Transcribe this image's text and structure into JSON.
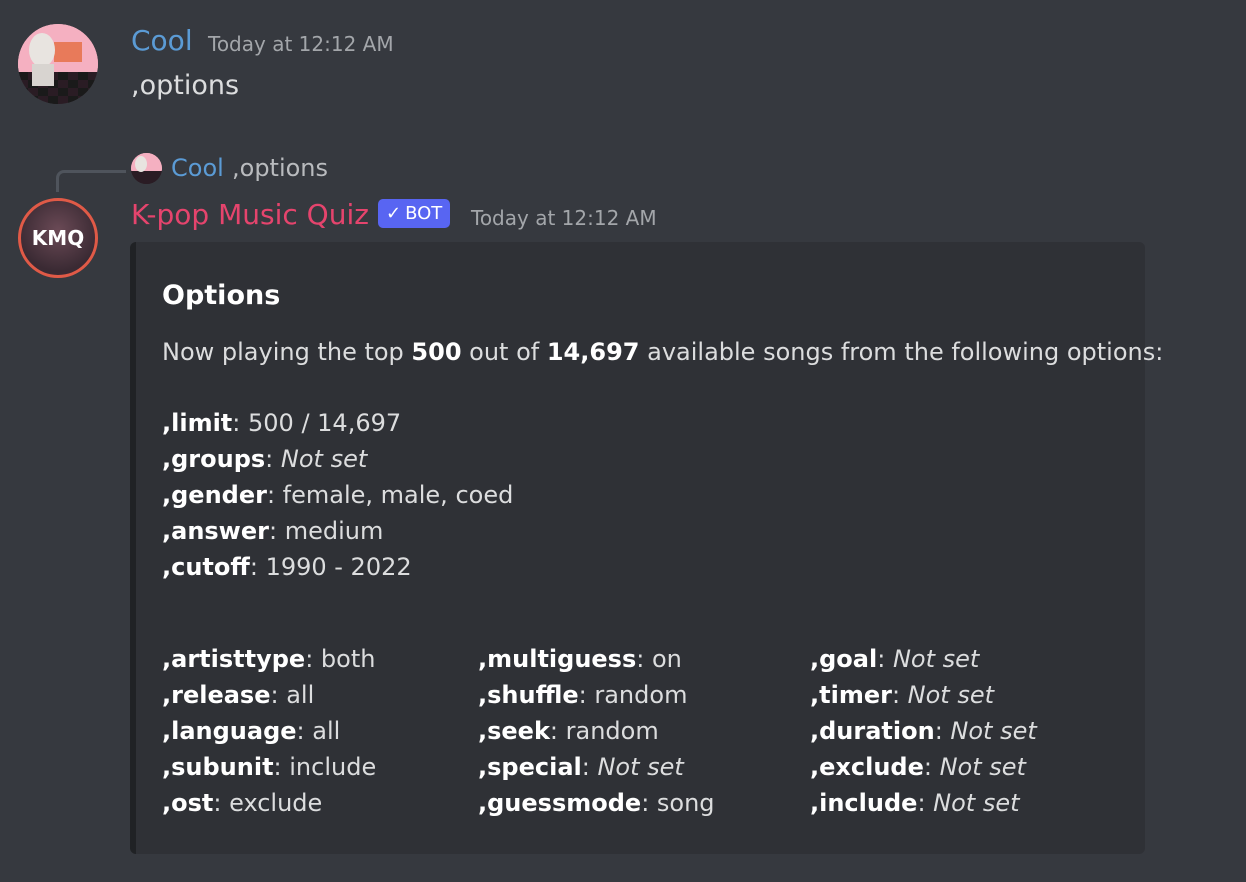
{
  "message1": {
    "username": "Cool",
    "timestamp": "Today at 12:12 AM",
    "content": ",options"
  },
  "reply": {
    "username": "Cool",
    "content": ",options"
  },
  "message2": {
    "avatar_text": "KMQ",
    "username": "K-pop Music Quiz",
    "badge": "BOT",
    "badge_check": "✓",
    "timestamp": "Today at 12:12 AM",
    "embed": {
      "title": "Options",
      "desc_pre": "Now playing the top ",
      "desc_top": "500",
      "desc_mid": " out of ",
      "desc_total": "14,697",
      "desc_post": " available songs from the following options:",
      "main_options": [
        {
          "key": ",limit",
          "value": "500 / 14,697",
          "italic": false
        },
        {
          "key": ",groups",
          "value": "Not set",
          "italic": true
        },
        {
          "key": ",gender",
          "value": "female, male, coed",
          "italic": false
        },
        {
          "key": ",answer",
          "value": "medium",
          "italic": false
        },
        {
          "key": ",cutoff",
          "value": "1990 - 2022",
          "italic": false
        }
      ],
      "col1": [
        {
          "key": ",artisttype",
          "value": "both",
          "italic": false
        },
        {
          "key": ",release",
          "value": "all",
          "italic": false
        },
        {
          "key": ",language",
          "value": "all",
          "italic": false
        },
        {
          "key": ",subunit",
          "value": "include",
          "italic": false
        },
        {
          "key": ",ost",
          "value": "exclude",
          "italic": false
        }
      ],
      "col2": [
        {
          "key": ",multiguess",
          "value": "on",
          "italic": false
        },
        {
          "key": ",shuffle",
          "value": "random",
          "italic": false
        },
        {
          "key": ",seek",
          "value": "random",
          "italic": false
        },
        {
          "key": ",special",
          "value": "Not set",
          "italic": true
        },
        {
          "key": ",guessmode",
          "value": "song",
          "italic": false
        }
      ],
      "col3": [
        {
          "key": ",goal",
          "value": "Not set",
          "italic": true
        },
        {
          "key": ",timer",
          "value": "Not set",
          "italic": true
        },
        {
          "key": ",duration",
          "value": "Not set",
          "italic": true
        },
        {
          "key": ",exclude",
          "value": "Not set",
          "italic": true
        },
        {
          "key": ",include",
          "value": "Not set",
          "italic": true
        }
      ]
    }
  },
  "colors": {
    "background": "#36393f",
    "embed_bg": "#2f3136",
    "user_name": "#5b9bd5",
    "bot_name": "#e5446d",
    "bot_badge": "#5865f2"
  }
}
